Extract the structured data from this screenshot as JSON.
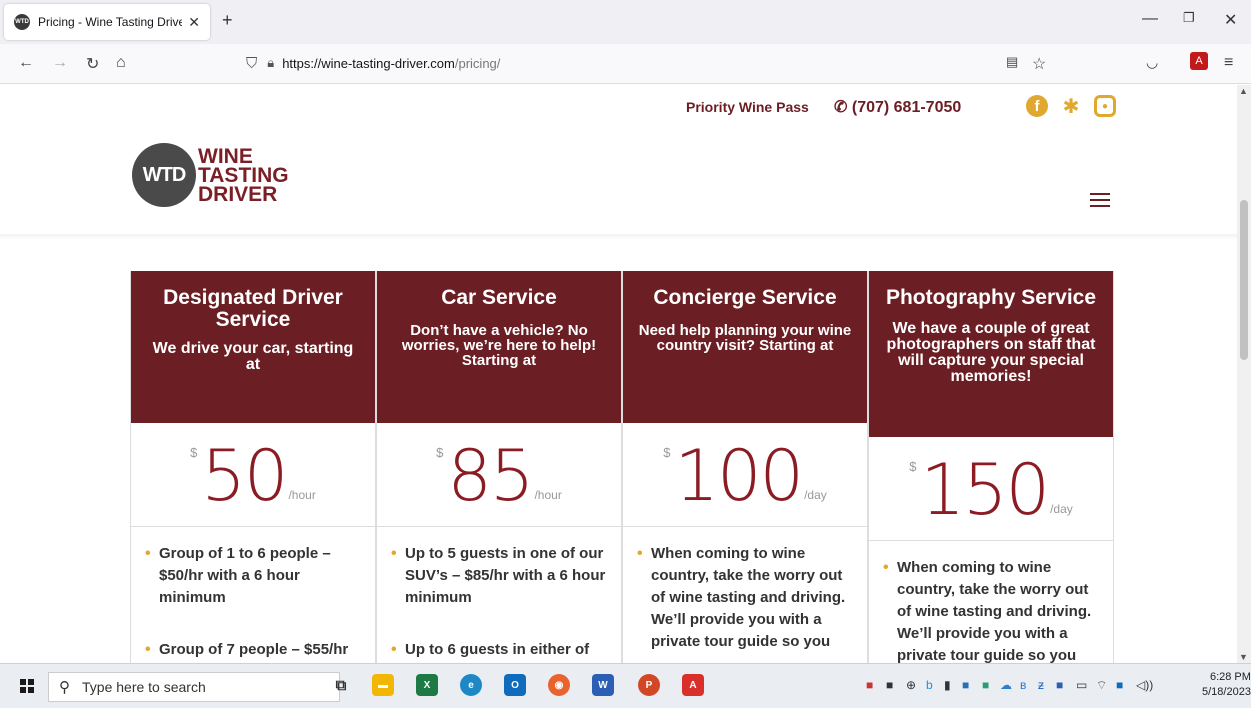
{
  "browser": {
    "tab_title": "Pricing - Wine Tasting Driver",
    "favicon_text": "WTD",
    "url_host": "https://wine-tasting-driver.com",
    "url_path": "/pricing/"
  },
  "site": {
    "nav_link": "Priority Wine Pass",
    "phone": "(707) 681-7050",
    "logo_mark": "WTD",
    "logo_line1": "WINE",
    "logo_line2": "TASTING",
    "logo_line3": "DRIVER",
    "brand_color": "#6b1e23",
    "accent_color": "#e0a82e"
  },
  "cards": [
    {
      "name": "Designated Driver Service",
      "desc": "We drive your car, starting at",
      "currency": "$",
      "amount": "50",
      "unit": "/hour",
      "features": [
        "Group of 1 to 6 people – $50/hr with a 6 hour minimum",
        "Group of 7 people – $55/hr"
      ]
    },
    {
      "name": "Car Service",
      "desc": "Don’t have a vehicle? No worries, we’re here to help! Starting at",
      "currency": "$",
      "amount": "85",
      "unit": "/hour",
      "features": [
        "Up to 5 guests in one of our SUV’s – $85/hr with a 6 hour minimum",
        "Up to 6 guests in either of"
      ]
    },
    {
      "name": "Concierge Service",
      "desc": "Need help planning your wine country visit? Starting at",
      "currency": "$",
      "amount": "100",
      "unit": "/day",
      "features": [
        "When coming to wine country, take the worry out of wine tasting and driving. We’ll provide you with a private tour guide so you"
      ]
    },
    {
      "name": "Photography Service",
      "desc": "We have a couple of great photographers on staff that will capture your special memories!",
      "currency": "$",
      "amount": "150",
      "unit": "/day",
      "features": [
        "When coming to wine country, take the worry out of wine tasting and driving. We’ll provide you with a private tour guide so you"
      ]
    }
  ],
  "taskbar": {
    "search_placeholder": "Type here to search",
    "time": "6:28 PM",
    "date": "5/18/2023"
  }
}
